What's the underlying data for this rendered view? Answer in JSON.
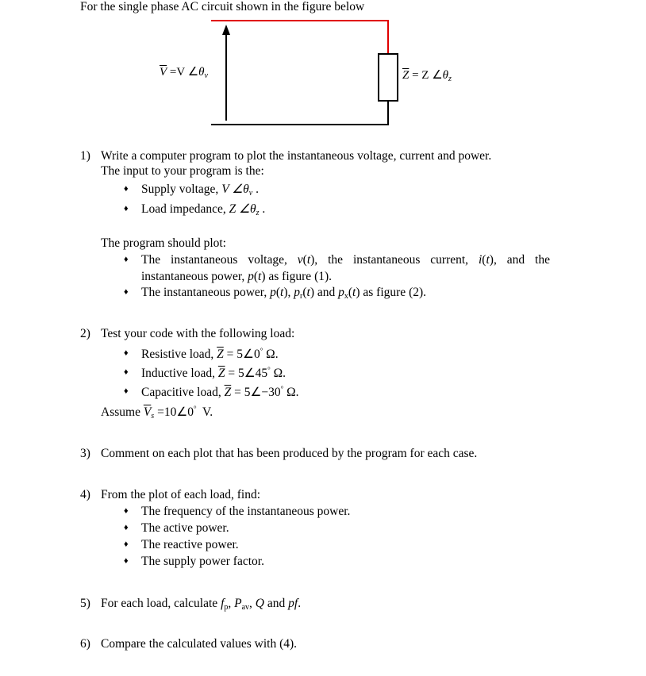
{
  "intro": "For the single phase AC circuit shown in the figure below",
  "circuit": {
    "source_label": {
      "sym": "V",
      "eq": " =V ",
      "angle": "∠",
      "theta": "θ",
      "sub": "v"
    },
    "load_label": {
      "sym": "Z",
      "eq": " = Z ",
      "angle": "∠",
      "theta": "θ",
      "sub": "z"
    },
    "colors": {
      "top_wire": "#e00000",
      "wire": "#000000"
    }
  },
  "q1": {
    "num": "1)",
    "line1": "Write a computer program to plot the instantaneous voltage, current and power.",
    "line2": "The input to your program is the:",
    "bullets": [
      {
        "text": "Supply voltage, ",
        "math": "V ∠θ",
        "sub": "v",
        "end": " ."
      },
      {
        "text": "Load impedance, ",
        "math": "Z ∠θ",
        "sub": "z",
        "end": " ."
      }
    ],
    "plot_intro": "The program should plot:",
    "plot_bullets": [
      {
        "line1_a": "The instantaneous voltage, ",
        "v": "v",
        "line1_b": "(",
        "t1": "t",
        "line1_c": "), the instantaneous current, ",
        "i": "i",
        "line1_d": "(",
        "t2": "t",
        "line1_e": "), and the",
        "line2_a": "instantaneous power, ",
        "p": "p",
        "line2_b": "(",
        "t3": "t",
        "line2_c": ") as figure (1)."
      },
      {
        "a": "The instantaneous power, ",
        "p": "p",
        "b": "(",
        "t": "t",
        "c": "), ",
        "pr": "p",
        "pr_sub": "r",
        "d": "(",
        "t2": "t",
        "e": ") and ",
        "px": "p",
        "px_sub": "x",
        "f": "(",
        "t3": "t",
        "g": ") as figure (2)."
      }
    ]
  },
  "q2": {
    "num": "2)",
    "title": "Test your code with the following load:",
    "loads": [
      {
        "label": "Resistive load, ",
        "mag": "5",
        "angle": "0",
        "unit": "Ω."
      },
      {
        "label": "Inductive load, ",
        "mag": "5",
        "angle": "45",
        "unit": "Ω."
      },
      {
        "label": "Capacitive load, ",
        "mag": "5",
        "angle": "−30",
        "unit": "Ω."
      }
    ],
    "assume": {
      "pre": "Assume ",
      "sym": "V",
      "sub": "s",
      "eq": " =10∠0",
      "deg": "°",
      "unit": "  V."
    }
  },
  "q3": {
    "num": "3)",
    "text": "Comment on each plot that has been produced by the program for each case."
  },
  "q4": {
    "num": "4)",
    "title": "From the plot of each load, find:",
    "bullets": [
      "The frequency of the instantaneous power.",
      "The active power.",
      "The reactive power.",
      "The supply power factor."
    ]
  },
  "q5": {
    "num": "5)",
    "pre": "For each load, calculate ",
    "fp": "f",
    "fp_sub": "p",
    "c1": ", ",
    "pav": "P",
    "pav_sub": "av",
    "c2": ", ",
    "q": "Q",
    "and": " and ",
    "pf": "pf",
    "end": "."
  },
  "q6": {
    "num": "6)",
    "text": "Compare the calculated values with (4)."
  },
  "symbols": {
    "bullet": "♦",
    "angle": "∠",
    "deg": "°",
    "eq": " = "
  }
}
